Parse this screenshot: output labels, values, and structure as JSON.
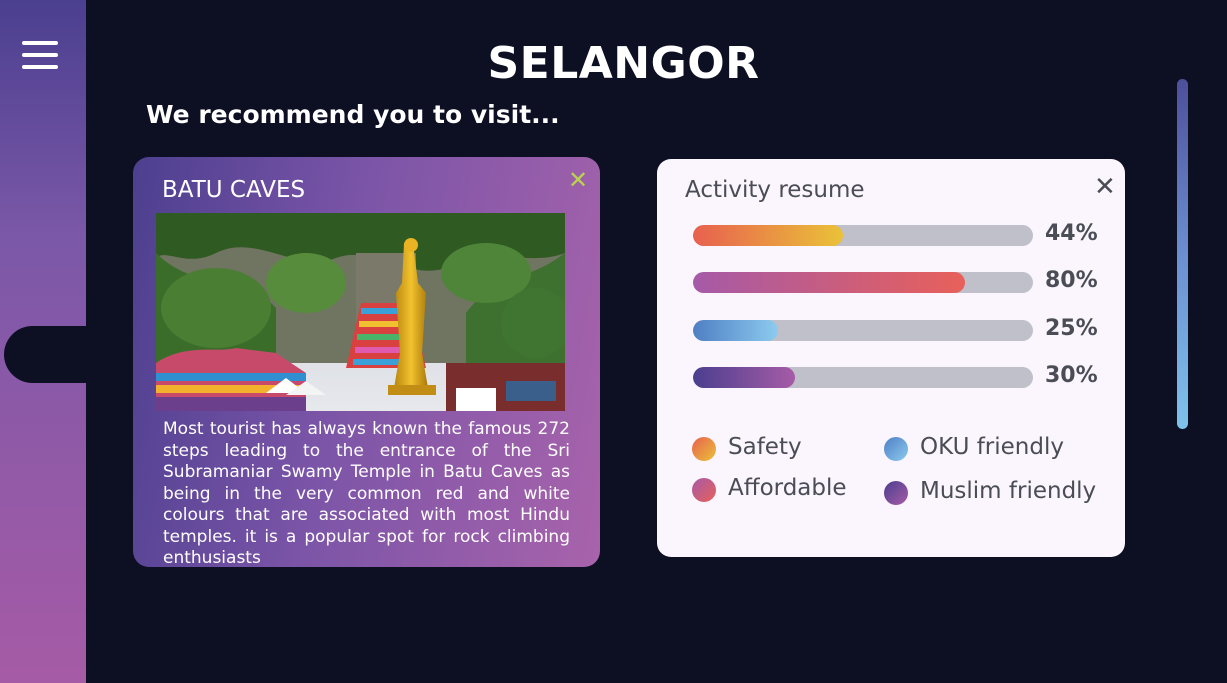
{
  "header": {
    "title": "SELANGOR",
    "subtitle": "We recommend you to visit..."
  },
  "sidebar": {
    "menu_icon": "hamburger-menu-icon"
  },
  "place": {
    "name": "BATU CAVES",
    "close_icon": "close-icon",
    "close_color": "#b8d44f",
    "description": "Most tourist has always known the famous 272 steps leading to the entrance of the Sri Subramaniar Swamy Temple in Batu Caves as being in the very common red and white colours that are associated with most Hindu temples. it is a popular spot for rock climbing enthusiasts"
  },
  "activity": {
    "title": "Activity resume",
    "close_icon": "close-icon",
    "bars": [
      {
        "category": "Safety",
        "value": 44,
        "label": "44%",
        "gradient": [
          "#e8604f",
          "#eac238"
        ]
      },
      {
        "category": "Affordable",
        "value": 80,
        "label": "80%",
        "gradient": [
          "#a65aa8",
          "#e8605a"
        ]
      },
      {
        "category": "OKU friendly",
        "value": 25,
        "label": "25%",
        "gradient": [
          "#4f7fc4",
          "#8ccbef"
        ]
      },
      {
        "category": "Muslim friendly",
        "value": 30,
        "label": "30%",
        "gradient": [
          "#4b3f8f",
          "#a65ba6"
        ]
      }
    ],
    "legend": [
      {
        "label": "Safety",
        "gradient": [
          "#e8604f",
          "#eac238"
        ]
      },
      {
        "label": "OKU friendly",
        "gradient": [
          "#4f7fc4",
          "#8ccbef"
        ]
      },
      {
        "label": "Affordable",
        "gradient": [
          "#a65aa8",
          "#e8605a"
        ]
      },
      {
        "label": "Muslim friendly",
        "gradient": [
          "#4b3f8f",
          "#a65ba6"
        ]
      }
    ]
  },
  "colors": {
    "background": "#0d0f22",
    "sidebar_top": "#4b3f8f",
    "sidebar_bottom": "#a65ba6",
    "card_bg": "#fbf5fd",
    "text_dark": "#4a4d55"
  }
}
